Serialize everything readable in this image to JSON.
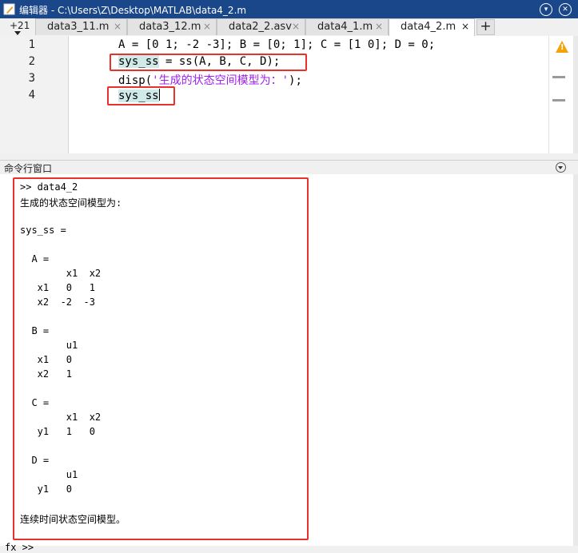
{
  "window": {
    "title": "编辑器 - C:\\Users\\Z\\Desktop\\MATLAB\\data4_2.m"
  },
  "tabs": {
    "counter": "+21",
    "items": [
      {
        "label": "data3_11.m",
        "close": "×"
      },
      {
        "label": "data3_12.m",
        "close": "×"
      },
      {
        "label": "data2_2.asv",
        "close": "×"
      },
      {
        "label": "data4_1.m",
        "close": "×"
      },
      {
        "label": "data4_2.m",
        "close": "×"
      }
    ],
    "add": "+"
  },
  "editor": {
    "line_numbers": [
      "1",
      "2",
      "3",
      "4"
    ],
    "line1": "A = [0 1; -2 -3]; B = [0; 1]; C = [1 0]; D = 0;",
    "line2_var": "sys_ss",
    "line2_rest": " = ss(A, B, C, D);",
    "line3_fn": "disp(",
    "line3_str": "'生成的状态空间模型为：'",
    "line3_end": ");",
    "line4": "sys_ss",
    "status_icon": "warning-icon"
  },
  "command_window": {
    "title": "命令行窗口",
    "lines": [
      ">> data4_2",
      "生成的状态空间模型为:",
      "",
      "sys_ss =",
      "",
      "  A = ",
      "        x1  x2",
      "   x1   0   1",
      "   x2  -2  -3",
      "",
      "  B = ",
      "        u1",
      "   x1   0",
      "   x2   1",
      "",
      "  C = ",
      "        x1  x2",
      "   y1   1   0",
      "",
      "  D = ",
      "        u1",
      "   y1   0",
      "",
      "连续时间状态空间模型。"
    ],
    "prompt": "fx >>"
  },
  "colors": {
    "annotation": "#e8312a",
    "titlebar": "#19478a",
    "string": "#a020f0",
    "highlight": "#d0eaea"
  }
}
